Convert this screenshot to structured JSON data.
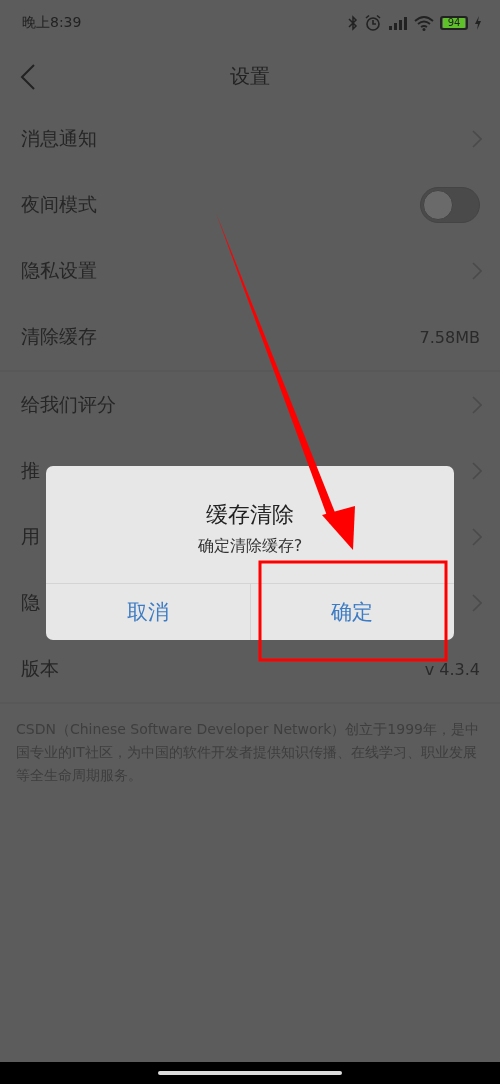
{
  "status_bar": {
    "time": "晚上8:39",
    "battery": "94"
  },
  "header": {
    "title": "设置"
  },
  "sections": [
    {
      "items": [
        {
          "kind": "link",
          "label": "消息通知"
        },
        {
          "kind": "toggle",
          "label": "夜间模式",
          "on": false
        },
        {
          "kind": "link",
          "label": "隐私设置"
        },
        {
          "kind": "value",
          "label": "清除缓存",
          "value": "7.58MB"
        }
      ]
    },
    {
      "items": [
        {
          "kind": "link",
          "label": "给我们评分"
        },
        {
          "kind": "link",
          "label": "推"
        },
        {
          "kind": "link",
          "label": "用"
        },
        {
          "kind": "link",
          "label": "隐"
        },
        {
          "kind": "value",
          "label": "版本",
          "value": "v 4.3.4"
        }
      ]
    }
  ],
  "footer": "CSDN（Chinese Software Developer Network）创立于1999年，是中国专业的IT社区，为中国的软件开发者提供知识传播、在线学习、职业发展等全生命周期服务。",
  "dialog": {
    "title": "缓存清除",
    "message": "确定清除缓存?",
    "buttons": [
      {
        "label": "取消"
      },
      {
        "label": "确定"
      }
    ]
  }
}
